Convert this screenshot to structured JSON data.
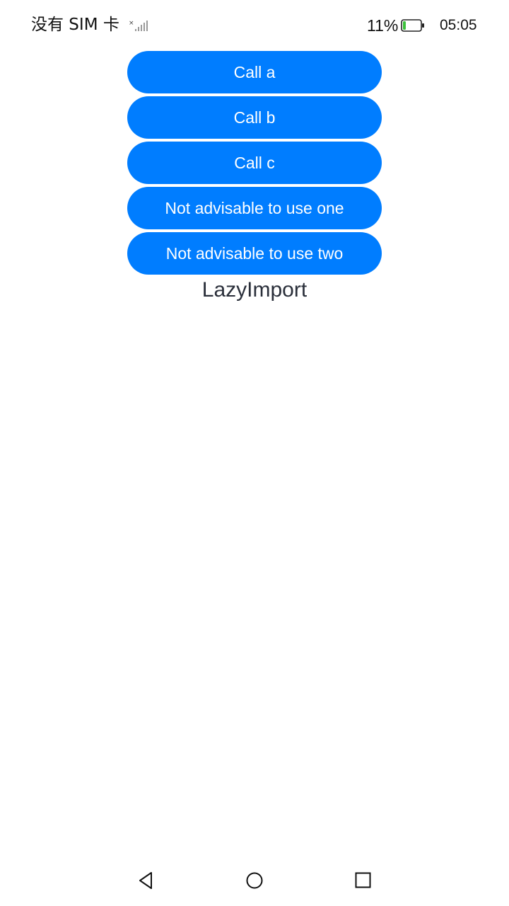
{
  "status_bar": {
    "carrier": "没有 SIM 卡",
    "signal_icon": "no-signal-icon",
    "battery_percent": "11%",
    "battery_icon": "battery-low-icon",
    "time": "05:05",
    "battery_level": 0.11,
    "battery_color": "#3cc13b"
  },
  "main": {
    "buttons": [
      {
        "label": "Call a"
      },
      {
        "label": "Call b"
      },
      {
        "label": "Call c"
      },
      {
        "label": "Not advisable to use one"
      },
      {
        "label": "Not advisable to use two"
      }
    ],
    "title": "LazyImport",
    "accent_color": "#007dff"
  },
  "nav_bar": {
    "back_icon": "back-triangle-icon",
    "home_icon": "home-circle-icon",
    "recent_icon": "recent-square-icon"
  }
}
